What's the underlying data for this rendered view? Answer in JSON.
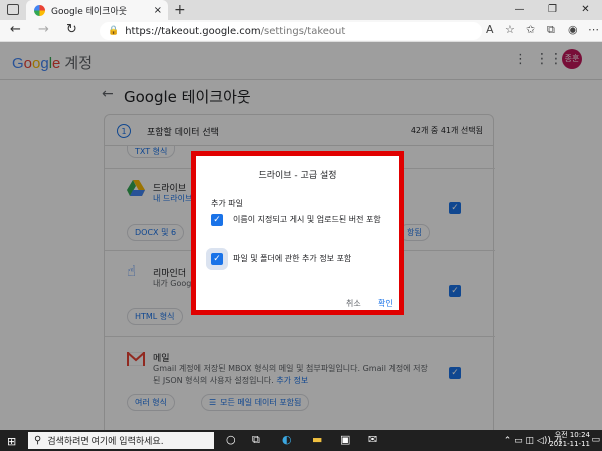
{
  "browser": {
    "tab_title": "Google 테이크아웃",
    "tab_close": "×",
    "new_tab": "+",
    "url_host": "https://takeout.google.com",
    "url_path": "/settings/takeout"
  },
  "header": {
    "logo": [
      "G",
      "o",
      "o",
      "g",
      "l",
      "e"
    ],
    "account_label": "계정",
    "avatar_text": "종훈"
  },
  "page": {
    "title": "Google 테이크아웃",
    "step_number": "1",
    "step_label": "포함할 데이터 선택",
    "step_count": "42개 중 41개 선택됨"
  },
  "list": {
    "top_chip": "TXT 형식",
    "drive": {
      "title": "드라이브",
      "sub": "내 드라이브",
      "chip1": "DOCX 및 6",
      "chip2": "항됨"
    },
    "reminder": {
      "title": "리마인더",
      "sub": "내가 Google",
      "chip": "HTML 형식"
    },
    "mail": {
      "title": "메일",
      "desc1": "Gmail 계정에 저장된 MBOX 형식의 메일 및 첨부파일입니다. Gmail 계정에 저장",
      "desc2": "된 JSON 형식의 사용자 설정입니다.",
      "more": "추가 정보",
      "chip1": "여러 형식",
      "chip2": "모든 메일 데이터 포함됨"
    }
  },
  "dialog": {
    "title": "드라이브 - 고급 설정",
    "section": "추가 파일",
    "options": [
      "이름이 지정되고 게시 및 업로드된 버전 포함",
      "파일 및 폴더에 관한 추가 정보 포함"
    ],
    "cancel": "취소",
    "ok": "확인"
  },
  "taskbar": {
    "search_placeholder": "검색하려면 여기에 입력하세요.",
    "time": "오전 10:24",
    "date": "2021-11-11"
  },
  "colors": {
    "accent": "#1a73e8",
    "highlight_border": "#e00000"
  }
}
